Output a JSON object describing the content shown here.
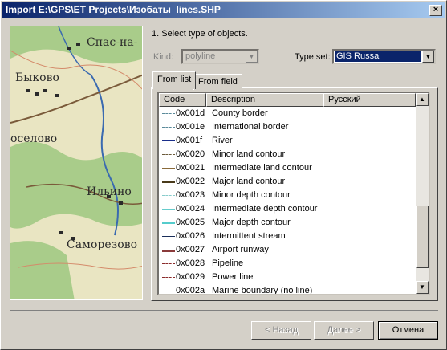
{
  "window": {
    "title": "Import E:\\GPS\\ET Projects\\Изобаты_lines.SHP",
    "close_glyph": "×"
  },
  "map_labels": [
    "Спас-на-",
    "Быково",
    "осело‍во",
    "Ильино",
    "Саморезово"
  ],
  "step_text": "1. Select type of objects.",
  "kind": {
    "label": "Kind:",
    "value": "polyline"
  },
  "typeset": {
    "label": "Type set:",
    "value": "GIS Russa"
  },
  "tabs": [
    "From list",
    "From field"
  ],
  "list": {
    "columns": [
      "Code",
      "Description",
      "Русский"
    ],
    "rows": [
      {
        "code": "0x001d",
        "desc": "County border",
        "color": "#5a8a9a",
        "style": "dashed",
        "w": 1
      },
      {
        "code": "0x001e",
        "desc": "International border",
        "color": "#5a8a9a",
        "style": "dashed",
        "w": 1
      },
      {
        "code": "0x001f",
        "desc": "River",
        "color": "#1a2e8a",
        "style": "solid",
        "w": 1
      },
      {
        "code": "0x0020",
        "desc": "Minor land contour",
        "color": "#6b5a3a",
        "style": "dashed",
        "w": 1
      },
      {
        "code": "0x0021",
        "desc": "Intermediate land contour",
        "color": "#8a6a3a",
        "style": "solid",
        "w": 1
      },
      {
        "code": "0x0022",
        "desc": "Major land contour",
        "color": "#4a3a1a",
        "style": "solid",
        "w": 2
      },
      {
        "code": "0x0023",
        "desc": "Minor depth contour",
        "color": "#88cccc",
        "style": "dashed",
        "w": 1
      },
      {
        "code": "0x0024",
        "desc": "Intermediate depth contour",
        "color": "#66cccc",
        "style": "solid",
        "w": 1
      },
      {
        "code": "0x0025",
        "desc": "Major depth contour",
        "color": "#55cccc",
        "style": "solid",
        "w": 2
      },
      {
        "code": "0x0026",
        "desc": "Intermittent stream",
        "color": "#1a2e5a",
        "style": "solid",
        "w": 1
      },
      {
        "code": "0x0027",
        "desc": "Airport runway",
        "color": "#8a3a3a",
        "style": "solid",
        "w": 3
      },
      {
        "code": "0x0028",
        "desc": "Pipeline",
        "color": "#8a2a2a",
        "style": "dashed",
        "w": 1
      },
      {
        "code": "0x0029",
        "desc": "Power line",
        "color": "#8a2a2a",
        "style": "dashed",
        "w": 1
      },
      {
        "code": "0x002a",
        "desc": "Marine boundary (no line)",
        "color": "#8a2a2a",
        "style": "dashed",
        "w": 1
      }
    ]
  },
  "buttons": {
    "back": "< Назад",
    "next": "Далее >",
    "cancel": "Отмена"
  }
}
